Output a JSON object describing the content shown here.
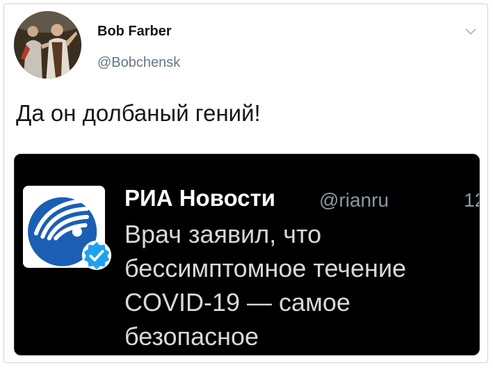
{
  "tweet": {
    "author_name": "Bob Farber",
    "author_handle": "@Bobchensk",
    "text": "Да он долбаный гений!",
    "avatar_icon": "user-avatar-photo",
    "menu_icon": "chevron-down-icon"
  },
  "quoted_tweet": {
    "author_name": "РИА Новости",
    "author_handle": "@rianru",
    "time_fragment": "12",
    "text": "Врач заявил, что бессимптомное течение COVID-19 — самое безопасное",
    "logo_icon": "ria-novosti-logo",
    "verified_icon": "verified-badge-icon"
  },
  "colors": {
    "card_background": "#000000",
    "verified_blue": "#1da1f2",
    "logo_blue": "#1a5fb4",
    "handle_gray": "#657786"
  }
}
